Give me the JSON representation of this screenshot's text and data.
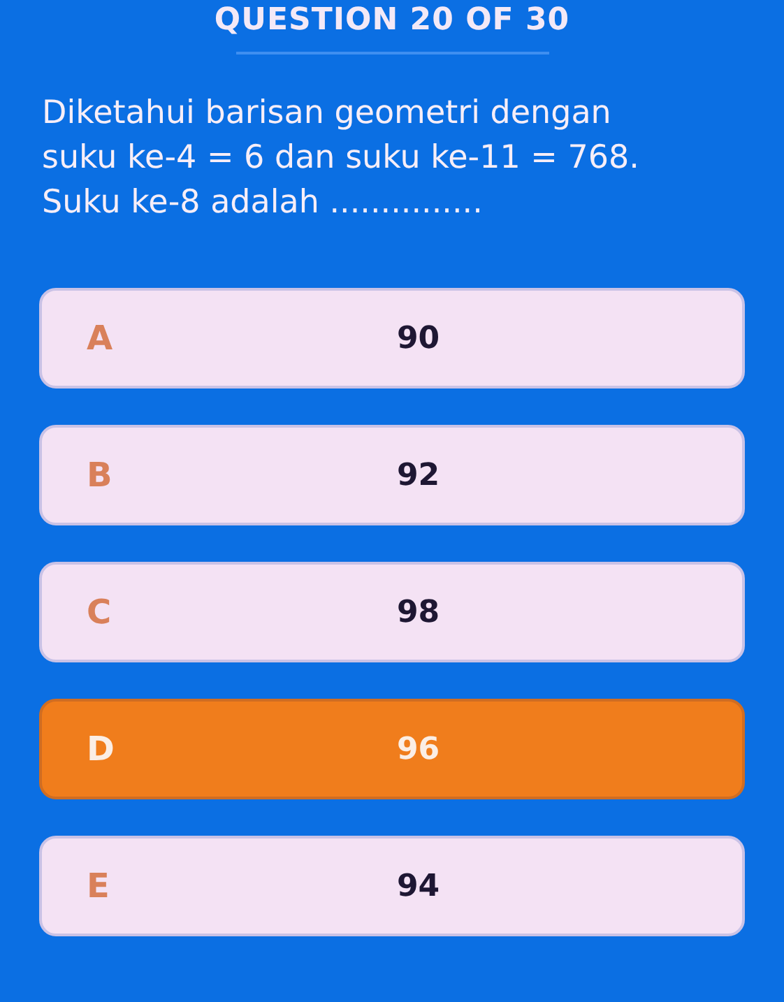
{
  "header": {
    "title": "QUESTION 20 OF 30"
  },
  "question": {
    "text": "Diketahui barisan geometri dengan suku ke-4 = 6 dan suku ke-11 = 768. Suku ke-8 adalah ..............."
  },
  "options": [
    {
      "letter": "A",
      "value": "90",
      "selected": false
    },
    {
      "letter": "B",
      "value": "92",
      "selected": false
    },
    {
      "letter": "C",
      "value": "98",
      "selected": false
    },
    {
      "letter": "D",
      "value": "96",
      "selected": true
    },
    {
      "letter": "E",
      "value": "94",
      "selected": false
    }
  ]
}
